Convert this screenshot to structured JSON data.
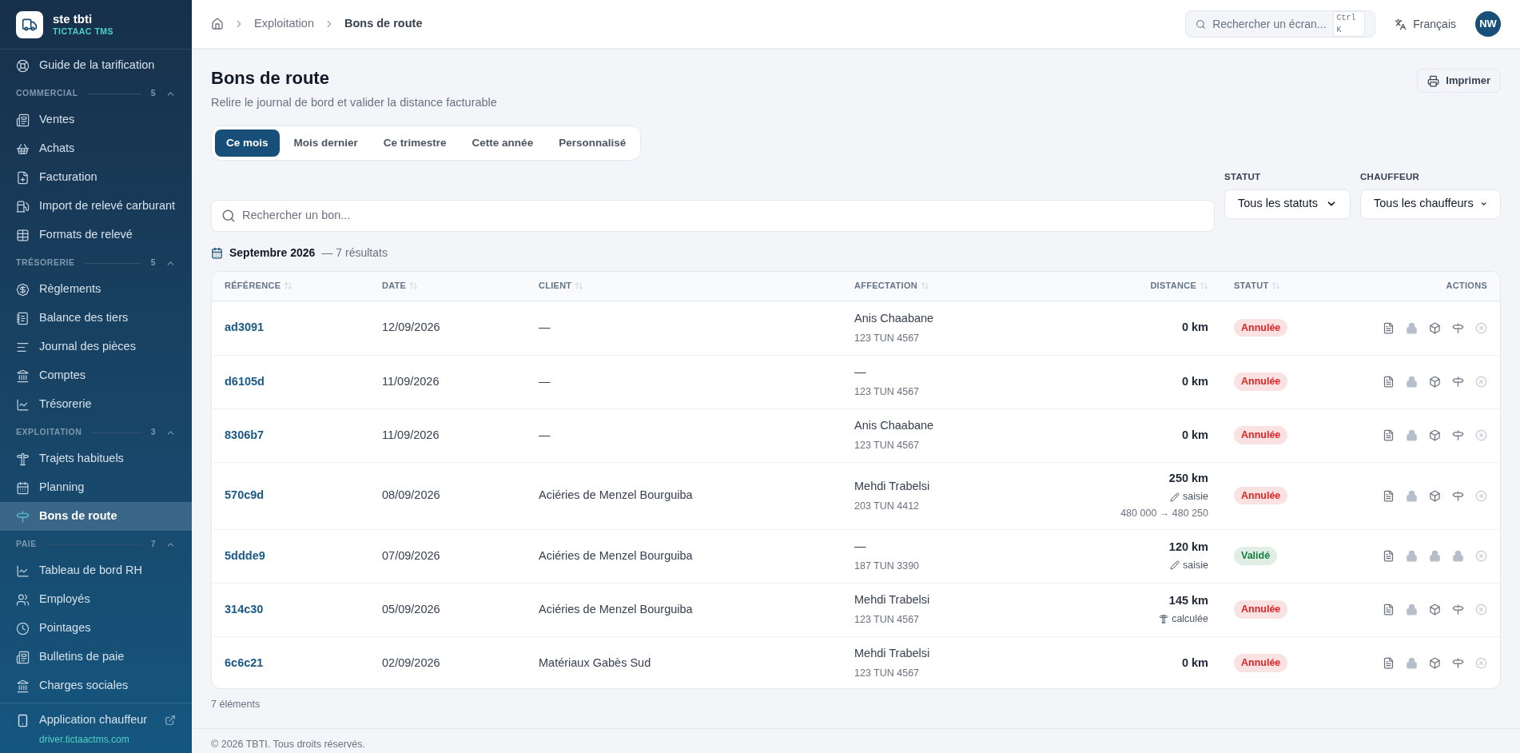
{
  "brand": {
    "name": "ste tbti",
    "product": "TICTAAC TMS"
  },
  "sidebar": {
    "top_items": [
      {
        "label": "Guide de la tarification",
        "selected": false
      }
    ],
    "sections": [
      {
        "title": "COMMERCIAL",
        "count": "5",
        "expanded": true,
        "items": [
          {
            "label": "Ventes",
            "selected": false
          },
          {
            "label": "Achats",
            "selected": false
          },
          {
            "label": "Facturation",
            "selected": false
          },
          {
            "label": "Import de relevé carburant",
            "selected": false
          },
          {
            "label": "Formats de relevé",
            "selected": false
          }
        ]
      },
      {
        "title": "TRÉSORERIE",
        "count": "5",
        "expanded": true,
        "items": [
          {
            "label": "Règlements",
            "selected": false
          },
          {
            "label": "Balance des tiers",
            "selected": false
          },
          {
            "label": "Journal des pièces",
            "selected": false
          },
          {
            "label": "Comptes",
            "selected": false
          },
          {
            "label": "Trésorerie",
            "selected": false
          }
        ]
      },
      {
        "title": "EXPLOITATION",
        "count": "3",
        "expanded": true,
        "items": [
          {
            "label": "Trajets habituels",
            "selected": false
          },
          {
            "label": "Planning",
            "selected": false
          },
          {
            "label": "Bons de route",
            "selected": true
          }
        ]
      },
      {
        "title": "PAIE",
        "count": "7",
        "expanded": true,
        "items": [
          {
            "label": "Tableau de bord RH",
            "selected": false
          },
          {
            "label": "Employés",
            "selected": false
          },
          {
            "label": "Pointages",
            "selected": false
          },
          {
            "label": "Bulletins de paie",
            "selected": false
          },
          {
            "label": "Charges sociales",
            "selected": false
          }
        ]
      }
    ],
    "footer": {
      "label": "Application chauffeur",
      "link": "driver.tictaactms.com"
    }
  },
  "header": {
    "breadcrumb": [
      "Exploitation",
      "Bons de route"
    ],
    "search": {
      "placeholder": "Rechercher un écran...",
      "shortcut": "Ctrl K"
    },
    "language": "Français",
    "avatar": "NW"
  },
  "page": {
    "title": "Bons de route",
    "subtitle": "Relire le journal de bord et valider la distance facturable",
    "print_button": "Imprimer"
  },
  "tabs": [
    {
      "label": "Ce mois",
      "selected": true
    },
    {
      "label": "Mois dernier",
      "selected": false
    },
    {
      "label": "Ce trimestre",
      "selected": false
    },
    {
      "label": "Cette année",
      "selected": false
    },
    {
      "label": "Personnalisé",
      "selected": false
    }
  ],
  "search": {
    "placeholder": "Rechercher un bon..."
  },
  "filters": [
    {
      "label": "STATUT",
      "value": "Tous les statuts"
    },
    {
      "label": "CHAUFFEUR",
      "value": "Tous les chauffeurs"
    }
  ],
  "results": {
    "period": "Septembre 2026",
    "count": "— 7 résultats"
  },
  "table": {
    "columns": [
      {
        "label": "RÉFÉRENCE",
        "sortable": true
      },
      {
        "label": "DATE",
        "sortable": true
      },
      {
        "label": "CLIENT",
        "sortable": true
      },
      {
        "label": "AFFECTATION",
        "sortable": true
      },
      {
        "label": "DISTANCE",
        "sortable": true
      },
      {
        "label": "STATUT",
        "sortable": true
      },
      {
        "label": "ACTIONS",
        "sortable": false
      }
    ],
    "rows": [
      {
        "reference": "ad3091",
        "date": "12/09/2026",
        "client": "—",
        "driver": "Anis Chaabane",
        "plate": "123 TUN 4567",
        "distance": "0 km",
        "status": {
          "label": "Annulée",
          "color": "#dc2626"
        },
        "locked": false
      },
      {
        "reference": "d6105d",
        "date": "11/09/2026",
        "client": "—",
        "driver": "—",
        "plate": "123 TUN 4567",
        "distance": "0 km",
        "status": {
          "label": "Annulée",
          "color": "#dc2626"
        },
        "locked": false
      },
      {
        "reference": "8306b7",
        "date": "11/09/2026",
        "client": "—",
        "driver": "Anis Chaabane",
        "plate": "123 TUN 4567",
        "distance": "0 km",
        "status": {
          "label": "Annulée",
          "color": "#dc2626"
        },
        "locked": false
      },
      {
        "reference": "570c9d",
        "date": "08/09/2026",
        "client": "Aciéries de Menzel Bourguiba",
        "driver": "Mehdi Trabelsi",
        "plate": "203 TUN 4412",
        "distance": "250 km",
        "source": {
          "kind": "manual",
          "label": "saisie"
        },
        "odometer": "480 000 → 480 250",
        "status": {
          "label": "Annulée",
          "color": "#dc2626"
        },
        "locked": false
      },
      {
        "reference": "5ddde9",
        "date": "07/09/2026",
        "client": "Aciéries de Menzel Bourguiba",
        "driver": "—",
        "plate": "187 TUN 3390",
        "distance": "120 km",
        "source": {
          "kind": "manual",
          "label": "saisie"
        },
        "status": {
          "label": "Validé",
          "color": "#15803d"
        },
        "locked": true
      },
      {
        "reference": "314c30",
        "date": "05/09/2026",
        "client": "Aciéries de Menzel Bourguiba",
        "driver": "Mehdi Trabelsi",
        "plate": "123 TUN 4567",
        "distance": "145 km",
        "source": {
          "kind": "computed",
          "label": "calculée"
        },
        "status": {
          "label": "Annulée",
          "color": "#dc2626"
        },
        "locked": false
      },
      {
        "reference": "6c6c21",
        "date": "02/09/2026",
        "client": "Matériaux Gabès Sud",
        "driver": "Mehdi Trabelsi",
        "plate": "123 TUN 4567",
        "distance": "0 km",
        "status": {
          "label": "Annulée",
          "color": "#dc2626"
        },
        "locked": false
      }
    ]
  },
  "item_count": "7 éléments",
  "footer": "© 2026 TBTI. Tous droits réservés."
}
